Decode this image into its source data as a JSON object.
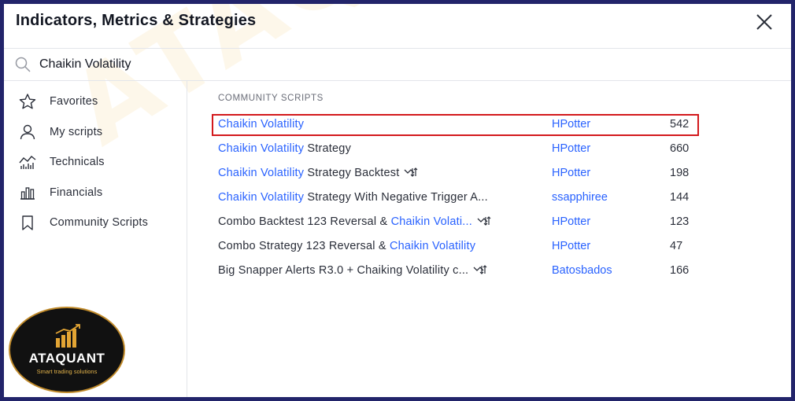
{
  "dialog": {
    "title": "Indicators, Metrics & Strategies"
  },
  "search": {
    "value": "Chaikin Volatility",
    "icon": "search-icon"
  },
  "sidebar": {
    "items": [
      {
        "label": "Favorites",
        "icon": "star-icon"
      },
      {
        "label": "My scripts",
        "icon": "user-icon"
      },
      {
        "label": "Technicals",
        "icon": "technicals-chart-icon"
      },
      {
        "label": "Financials",
        "icon": "bar-chart-icon"
      },
      {
        "label": "Community Scripts",
        "icon": "bookmark-icon"
      }
    ]
  },
  "content": {
    "section_title": "COMMUNITY SCRIPTS",
    "rows": [
      {
        "name_hl": "Chaikin Volatility",
        "name_rest": "",
        "author": "HPotter",
        "count": "542"
      },
      {
        "name_hl": "Chaikin Volatility",
        "name_rest": " Strategy",
        "author": "HPotter",
        "count": "660"
      },
      {
        "name_hl": "Chaikin Volatility",
        "name_rest": " Strategy Backtest",
        "author": "HPotter",
        "count": "198"
      },
      {
        "name_hl": "Chaikin Volatility",
        "name_rest": " Strategy With Negative Trigger A...",
        "author": "ssapphiree",
        "count": "144"
      },
      {
        "name_pre": "Combo Backtest 123 Reversal & ",
        "name_hl": "Chaikin Volati...",
        "author": "HPotter",
        "count": "123"
      },
      {
        "name_pre": "Combo Strategy 123 Reversal & ",
        "name_hl": "Chaikin Volatility",
        "author": "HPotter",
        "count": "47"
      },
      {
        "name_pre": "Big Snapper Alerts R3.0 + Chaiking Volatility c...",
        "name_hl": "",
        "author": "Batosbados",
        "count": "166"
      }
    ]
  },
  "watermark": "ATAQUANT",
  "logo": {
    "name": "ATAQUANT",
    "tagline": "Smart trading solutions"
  },
  "colors": {
    "frame": "#22246a",
    "link_blue": "#2962ff",
    "highlight_red": "#d3191c",
    "logo_gold": "#c08a2a"
  }
}
